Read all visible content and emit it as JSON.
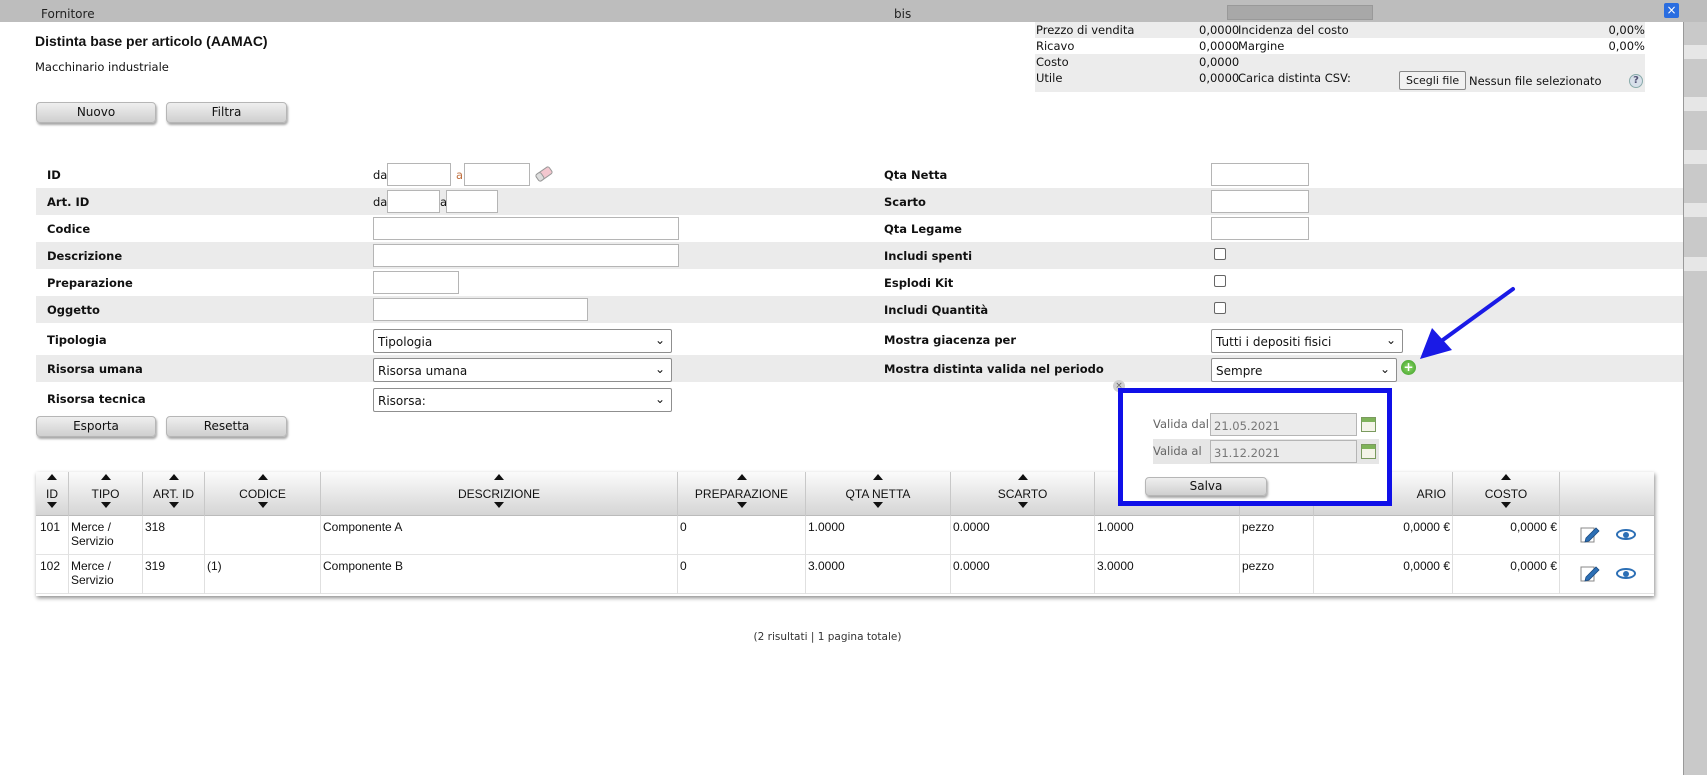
{
  "topbar": {
    "left_label": "Fornitore",
    "mid_label": "bis",
    "close_glyph": "×"
  },
  "header": {
    "title": "Distinta base per articolo (AAMAC)",
    "subtitle": "Macchinario industriale"
  },
  "summary": {
    "prezzo_label": "Prezzo di vendita",
    "prezzo_value": "0,0000",
    "incidenza_label": "Incidenza del costo",
    "incidenza_value": "0,00%",
    "ricavo_label": "Ricavo",
    "ricavo_value": "0,0000",
    "margine_label": "Margine",
    "margine_value": "0,00%",
    "costo_label": "Costo",
    "costo_value": "0,0000",
    "utile_label": "Utile",
    "utile_value": "0,0000",
    "csv_label": "Carica distinta CSV:",
    "file_button": "Scegli file",
    "file_status": "Nessun file selezionato",
    "help_glyph": "?"
  },
  "toolbar": {
    "new_label": "Nuovo",
    "filter_label": "Filtra",
    "export_label": "Esporta",
    "reset_label": "Resetta"
  },
  "filters": {
    "id_label": "ID",
    "da": "da",
    "a": "a",
    "artid_label": "Art. ID",
    "codice_label": "Codice",
    "descrizione_label": "Descrizione",
    "preparazione_label": "Preparazione",
    "oggetto_label": "Oggetto",
    "tipologia_label": "Tipologia",
    "tipologia_value": "Tipologia",
    "risorsa_umana_label": "Risorsa umana",
    "risorsa_umana_value": "Risorsa umana",
    "risorsa_tecnica_label": "Risorsa tecnica",
    "risorsa_tecnica_value": "Risorsa:",
    "qta_netta_label": "Qta Netta",
    "scarto_label": "Scarto",
    "qta_legame_label": "Qta Legame",
    "includi_spenti_label": "Includi spenti",
    "esplodi_kit_label": "Esplodi Kit",
    "includi_quantita_label": "Includi Quantità",
    "mostra_giacenza_label": "Mostra giacenza per",
    "mostra_giacenza_value": "Tutti i depositi fisici",
    "mostra_distinta_label": "Mostra distinta valida nel periodo",
    "mostra_distinta_value": "Sempre",
    "chevron_glyph": "⌄"
  },
  "popup": {
    "valida_dal_label": "Valida dal",
    "valida_dal_value": "21.05.2021",
    "valida_al_label": "Valida al",
    "valida_al_value": "31.12.2021",
    "save_label": "Salva",
    "close_glyph": "×",
    "plus_glyph": "+"
  },
  "table": {
    "headers": [
      "ID",
      "TIPO",
      "ART. ID",
      "CODICE",
      "DESCRIZIONE",
      "PREPARAZIONE",
      "QTA NETTA",
      "SCARTO",
      "ARIO",
      "COSTO"
    ],
    "rows": [
      {
        "id": "101",
        "tipo1": "Merce /",
        "tipo2": "Servizio",
        "artid": "318",
        "codice": "",
        "descrizione": "Componente A",
        "preparazione": "0",
        "qta_netta": "1.0000",
        "scarto": "0.0000",
        "qta_legame": "1.0000",
        "um": "pezzo",
        "prezzo": "0,0000 €",
        "costo": "0,0000 €"
      },
      {
        "id": "102",
        "tipo1": "Merce /",
        "tipo2": "Servizio",
        "artid": "319",
        "codice": "(1)",
        "descrizione": "Componente B",
        "preparazione": "0",
        "qta_netta": "3.0000",
        "scarto": "0.0000",
        "qta_legame": "3.0000",
        "um": "pezzo",
        "prezzo": "0,0000 €",
        "costo": "0,0000 €"
      }
    ]
  },
  "pager": {
    "text": "(2 risultati | 1 pagina totale)"
  },
  "colors": {
    "highlight": "#1010e8",
    "arrow": "#1a1ae6",
    "icon_blue": "#2c6fb5"
  }
}
